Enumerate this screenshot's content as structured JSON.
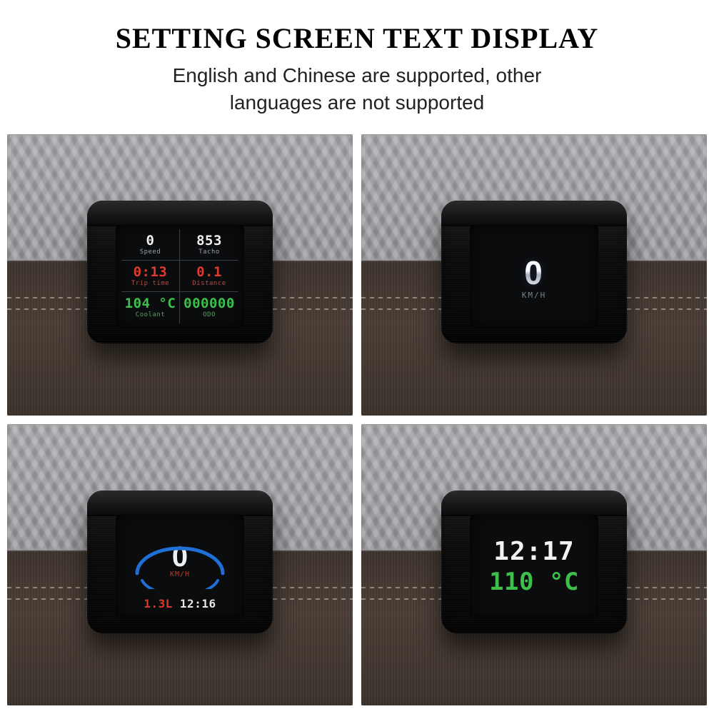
{
  "header": {
    "title": "SETTING SCREEN TEXT DISPLAY",
    "subtitle_line1": "English and Chinese are supported, other",
    "subtitle_line2": "languages are not supported"
  },
  "panels": {
    "top_left": {
      "speed": {
        "value": "0",
        "label": "Speed"
      },
      "tacho": {
        "value": "853",
        "label": "Tacho"
      },
      "triptime": {
        "value": "0:13",
        "label": "Trip time"
      },
      "distance": {
        "value": "0.1",
        "label": "Distance"
      },
      "coolant": {
        "value": "104 °C",
        "label": "Coolant"
      },
      "odo": {
        "value": "000000",
        "label": "ODO"
      }
    },
    "top_right": {
      "speed_value": "0",
      "speed_unit": "KM/H"
    },
    "bottom_left": {
      "speed_value": "0",
      "speed_unit": "KM/H",
      "fuel": "1.3L",
      "clock": "12:16"
    },
    "bottom_right": {
      "clock": "12:17",
      "temp": "110 °C"
    }
  }
}
